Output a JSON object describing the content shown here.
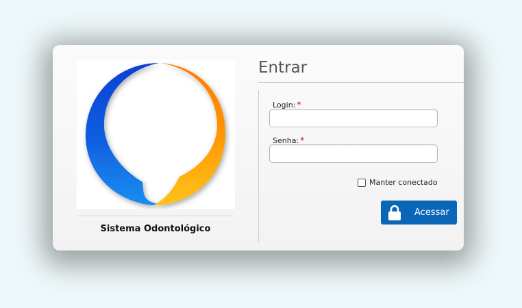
{
  "app": {
    "name": "Sistema Odontológico",
    "logo_icon": "speech-bubble-logo-icon"
  },
  "form": {
    "title": "Entrar",
    "login_label": "Login:",
    "login_value": "",
    "password_label": "Senha:",
    "password_value": "",
    "required_mark": "*",
    "remember_label": "Manter conectado",
    "remember_checked": false,
    "submit_label": "Acessar",
    "submit_icon": "lock-icon"
  },
  "colors": {
    "button": "#0a66b7",
    "logo_blue": "#1057d8",
    "logo_orange": "#ff8a00",
    "logo_yellow": "#ffc21a",
    "required": "#cc0000"
  }
}
